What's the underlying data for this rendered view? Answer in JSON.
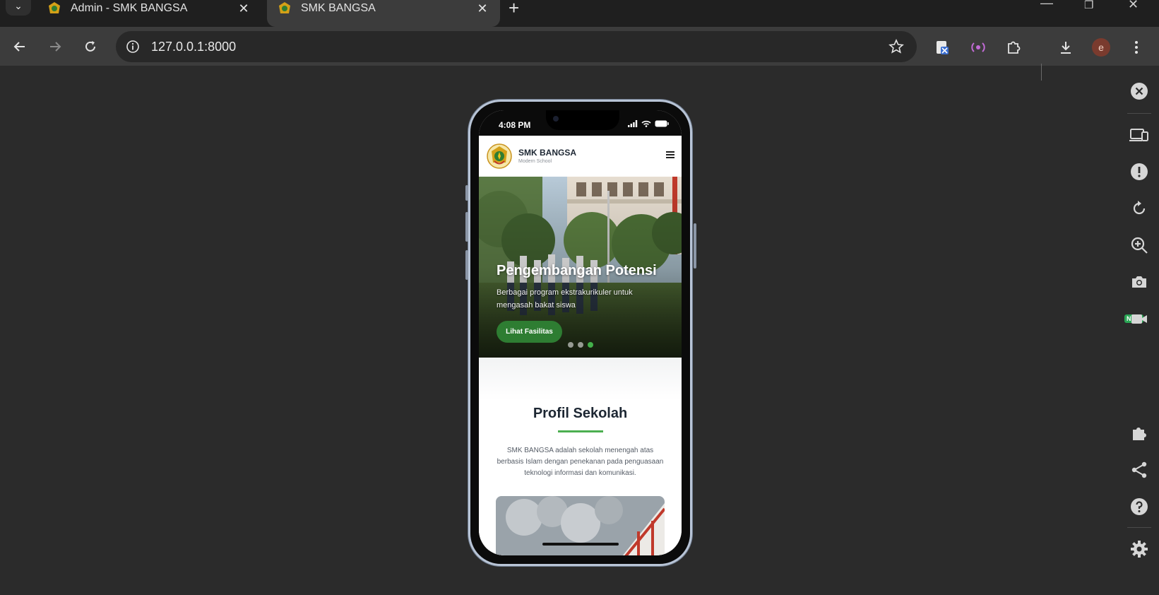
{
  "browser": {
    "tabs": [
      {
        "title": "Admin - SMK BANGSA",
        "active": false
      },
      {
        "title": "SMK BANGSA",
        "active": true
      }
    ],
    "url": "127.0.0.1:8000",
    "profile_initial": "e"
  },
  "side_panel": {
    "new_badge": "NEW"
  },
  "phone": {
    "status_time": "4:08 PM",
    "site": {
      "brand": "SMK BANGSA",
      "brand_sub": "Modern School",
      "hero": {
        "title": "Pengembangan Potensi",
        "text": "Berbagai program ekstrakurikuler untuk mengasah bakat siswa",
        "button": "Lihat Fasilitas",
        "slides": 3,
        "active_slide": 3
      },
      "profile": {
        "title": "Profil Sekolah",
        "text": "SMK BANGSA adalah sekolah menengah atas berbasis Islam dengan penekanan pada penguasaan teknologi informasi dan komunikasi."
      }
    }
  },
  "colors": {
    "accent_green": "#2e7d32",
    "dot_active": "#43b04a",
    "divider_green": "#4caf50"
  }
}
